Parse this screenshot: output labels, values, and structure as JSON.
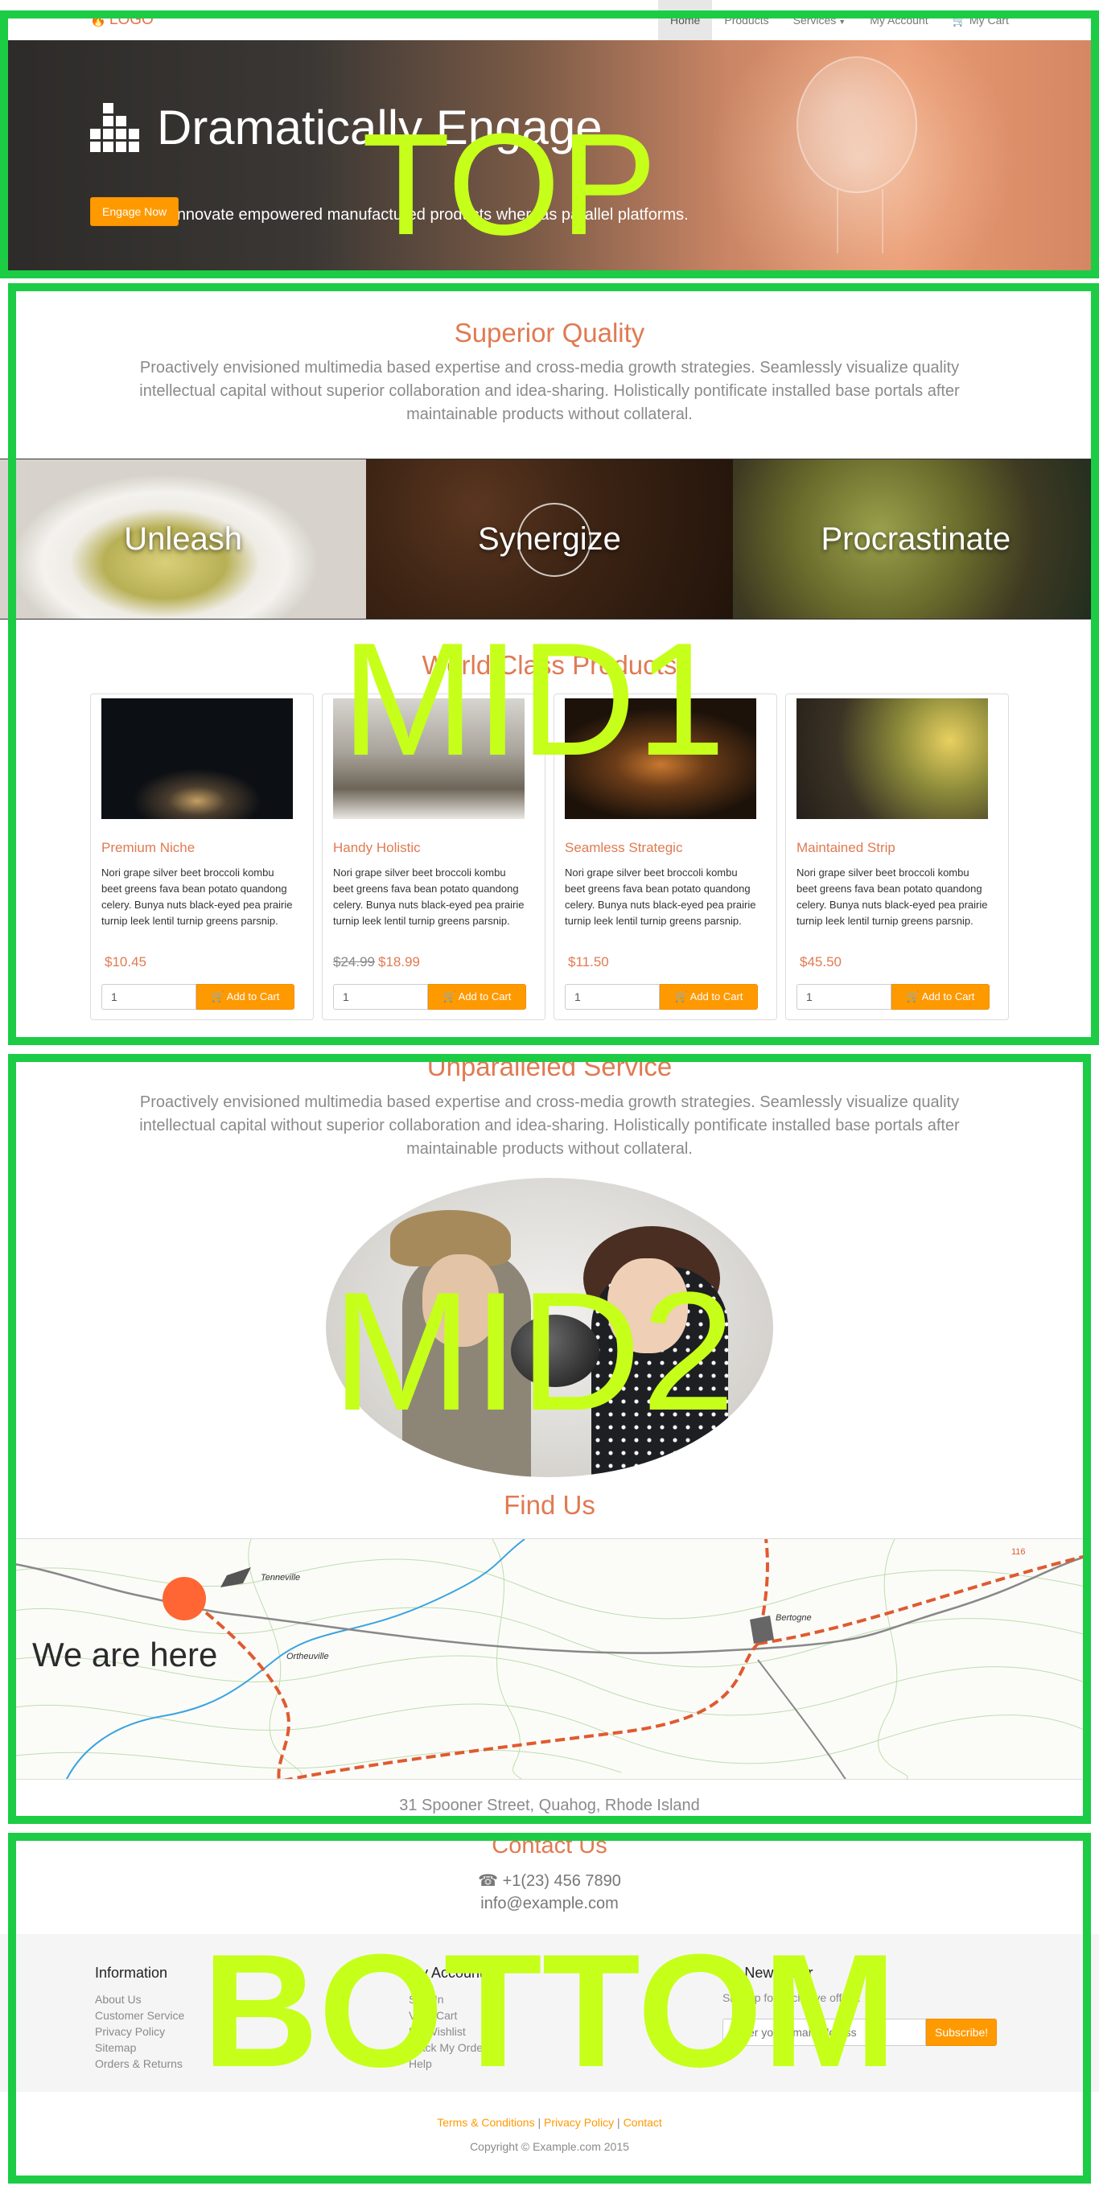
{
  "nav": {
    "logo": "LOGO",
    "items": [
      {
        "label": "Home"
      },
      {
        "label": "Products"
      },
      {
        "label": "Services"
      },
      {
        "label": "My Account"
      },
      {
        "label": "My Cart"
      }
    ]
  },
  "hero": {
    "title": "Dramatically Engage",
    "subtitle": "Objectively innovate empowered manufactured products whereas parallel platforms.",
    "button": "Engage Now"
  },
  "quality": {
    "title": "Superior Quality",
    "text": "Proactively envisioned multimedia based expertise and cross-media growth strategies. Seamlessly visualize quality intellectual capital without superior collaboration and idea-sharing. Holistically pontificate installed base portals after maintainable products without collateral."
  },
  "strip": [
    "Unleash",
    "Synergize",
    "Procrastinate"
  ],
  "products": {
    "title": "World Class Products",
    "add_label": "Add to Cart",
    "items": [
      {
        "name": "Premium Niche",
        "desc": "Nori grape silver beet broccoli kombu beet greens fava bean potato quandong celery. Bunya nuts black-eyed pea prairie turnip leek lentil turnip greens parsnip.",
        "old_price": "",
        "price": "$10.45",
        "qty": "1"
      },
      {
        "name": "Handy Holistic",
        "desc": "Nori grape silver beet broccoli kombu beet greens fava bean potato quandong celery. Bunya nuts black-eyed pea prairie turnip leek lentil turnip greens parsnip.",
        "old_price": "$24.99",
        "price": "$18.99",
        "qty": "1"
      },
      {
        "name": "Seamless Strategic",
        "desc": "Nori grape silver beet broccoli kombu beet greens fava bean potato quandong celery. Bunya nuts black-eyed pea prairie turnip leek lentil turnip greens parsnip.",
        "old_price": "",
        "price": "$11.50",
        "qty": "1"
      },
      {
        "name": "Maintained Strip",
        "desc": "Nori grape silver beet broccoli kombu beet greens fava bean potato quandong celery. Bunya nuts black-eyed pea prairie turnip leek lentil turnip greens parsnip.",
        "old_price": "",
        "price": "$45.50",
        "qty": "1"
      }
    ]
  },
  "service": {
    "title": "Unparalleled Service",
    "text": "Proactively envisioned multimedia based expertise and cross-media growth strategies. Seamlessly visualize quality intellectual capital without superior collaboration and idea-sharing. Holistically pontificate installed base portals after maintainable products without collateral."
  },
  "find": {
    "title": "Find Us",
    "map_label": "We are here",
    "places": [
      "Tenneville",
      "Ortheuville",
      "Bertogne"
    ],
    "route_badge": "116",
    "address": "31 Spooner Street, Quahog, Rhode Island"
  },
  "contact": {
    "title": "Contact Us",
    "phone": "+1(23) 456 7890",
    "email": "info@example.com"
  },
  "footer": {
    "info_title": "Information",
    "info_links": [
      "About Us",
      "Customer Service",
      "Privacy Policy",
      "Sitemap",
      "Orders & Returns"
    ],
    "account_title": "My Account",
    "account_links": [
      "Sign In",
      "View Cart",
      "My Wishlist",
      "Track My Order",
      "Help"
    ],
    "newsletter_title": "Newsletter",
    "newsletter_text": "Sign up for exclusive offers.",
    "newsletter_placeholder": "Enter your email address",
    "newsletter_button": "Subscribe!",
    "legal": [
      "Terms & Conditions",
      "Privacy Policy",
      "Contact"
    ],
    "copyright": "Copyright © Example.com 2015"
  },
  "overlay": {
    "top": "TOP",
    "mid1": "MID1",
    "mid2": "MID2",
    "bottom": "BOTTOM"
  },
  "colors": {
    "accent": "#e07a52",
    "button": "#ff9900",
    "frame": "#1ccc45",
    "overlay_text": "#c6ff1a"
  }
}
